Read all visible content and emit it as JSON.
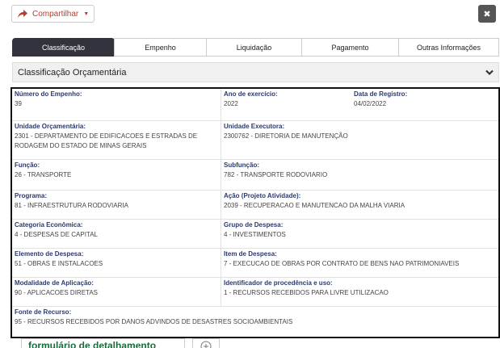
{
  "toolbar": {
    "share_label": "Compartilhar",
    "close_label": "✖"
  },
  "tabs": [
    {
      "label": "Classificação",
      "active": true
    },
    {
      "label": "Empenho",
      "active": false
    },
    {
      "label": "Liquidação",
      "active": false
    },
    {
      "label": "Pagamento",
      "active": false
    },
    {
      "label": "Outras Informações",
      "active": false
    }
  ],
  "section": {
    "title": "Classificação Orçamentária"
  },
  "fields": {
    "numero_empenho": {
      "label": "Número do Empenho:",
      "value": "39"
    },
    "ano_exercicio": {
      "label": "Ano de exercício:",
      "value": "2022"
    },
    "data_registro": {
      "label": "Data de Registro:",
      "value": "04/02/2022"
    },
    "unidade_orcamentaria": {
      "label": "Unidade Orçamentária:",
      "value": "2301 - DEPARTAMENTO DE EDIFICACOES E ESTRADAS DE RODAGEM DO ESTADO DE MINAS GERAIS"
    },
    "unidade_executora": {
      "label": "Unidade Executora:",
      "value": "2300762 - DIRETORIA DE MANUTENÇÃO"
    },
    "funcao": {
      "label": "Função:",
      "value": "26 - TRANSPORTE"
    },
    "subfuncao": {
      "label": "Subfunção:",
      "value": "782 - TRANSPORTE RODOVIARIO"
    },
    "programa": {
      "label": "Programa:",
      "value": "81 - INFRAESTRUTURA RODOVIARIA"
    },
    "acao": {
      "label": "Ação (Projeto Atividade):",
      "value": "2039 - RECUPERACAO E MANUTENCAO DA MALHA VIARIA"
    },
    "categoria_economica": {
      "label": "Categoria Econômica:",
      "value": "4 - DESPESAS DE CAPITAL"
    },
    "grupo_despesa": {
      "label": "Grupo de Despesa:",
      "value": "4 - INVESTIMENTOS"
    },
    "elemento_despesa": {
      "label": "Elemento de Despesa:",
      "value": "51 - OBRAS E INSTALACOES"
    },
    "item_despesa": {
      "label": "Item de Despesa:",
      "value": "7 - EXECUCAO DE OBRAS POR CONTRATO DE BENS NAO PATRIMONIAVEIS"
    },
    "modalidade_aplicacao": {
      "label": "Modalidade de Aplicação:",
      "value": "90 - APLICACOES DIRETAS"
    },
    "identificador_procedencia": {
      "label": "Identificador de procedência e uso:",
      "value": "1 - RECURSOS RECEBIDOS PARA LIVRE UTILIZACAO"
    },
    "fonte_recurso": {
      "label": "Fonte de Recurso:",
      "value": "95 - RECURSOS RECEBIDOS POR DANOS ADVINDOS DE DESASTRES SOCIOAMBIENTAIS"
    }
  },
  "bottom": {
    "tab_label": "formulário de detalhamento"
  },
  "colors": {
    "active_tab": "#33333d",
    "label": "#2b3a6e",
    "share": "#c0392b",
    "bottom_tab": "#1a6b3c"
  },
  "icons": [
    "share-icon",
    "caret-down-icon",
    "close-icon",
    "chevron-down-icon",
    "add-tab-icon"
  ]
}
